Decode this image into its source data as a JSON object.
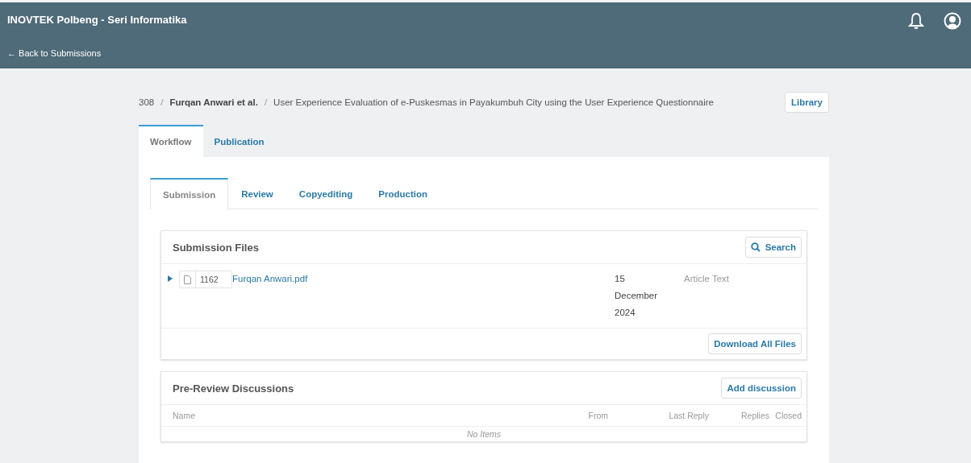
{
  "header": {
    "title": "INOVTEK Polbeng - Seri Informatika",
    "back_link": "← Back to Submissions"
  },
  "breadcrumb": {
    "id": "308",
    "separators": [
      "/",
      "/"
    ],
    "authors": "Furqan Anwari et al.",
    "title": "User Experience Evaluation of e-Puskesmas in Payakumbuh City using the User Experience Questionnaire",
    "library_button": "Library"
  },
  "tabs": [
    {
      "label": "Workflow",
      "selected": true
    },
    {
      "label": "Publication",
      "selected": false
    }
  ],
  "stage_tabs": [
    {
      "label": "Submission",
      "selected": true
    },
    {
      "label": "Review",
      "selected": false
    },
    {
      "label": "Copyediting",
      "selected": false
    },
    {
      "label": "Production",
      "selected": false
    }
  ],
  "submission_files": {
    "title": "Submission Files",
    "search_button": "Search",
    "files": [
      {
        "id": "1162",
        "name": "Furqan Anwari.pdf",
        "date": "15 December 2024",
        "type": "Article Text"
      }
    ],
    "download_button": "Download All Files"
  },
  "discussions": {
    "title": "Pre-Review Discussions",
    "add_button": "Add discussion",
    "columns": [
      "Name",
      "From",
      "Last Reply",
      "Replies",
      "Closed"
    ],
    "empty": "No Items"
  }
}
